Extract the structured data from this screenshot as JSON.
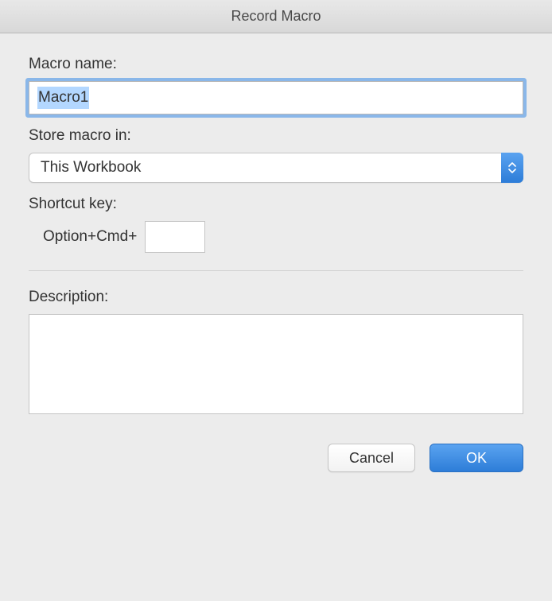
{
  "dialog": {
    "title": "Record Macro"
  },
  "fields": {
    "macro_name": {
      "label": "Macro name:",
      "value": "Macro1"
    },
    "store_in": {
      "label": "Store macro in:",
      "selected": "This Workbook"
    },
    "shortcut": {
      "label": "Shortcut key:",
      "prefix": "Option+Cmd+",
      "value": ""
    },
    "description": {
      "label": "Description:",
      "value": ""
    }
  },
  "buttons": {
    "cancel": "Cancel",
    "ok": "OK"
  }
}
